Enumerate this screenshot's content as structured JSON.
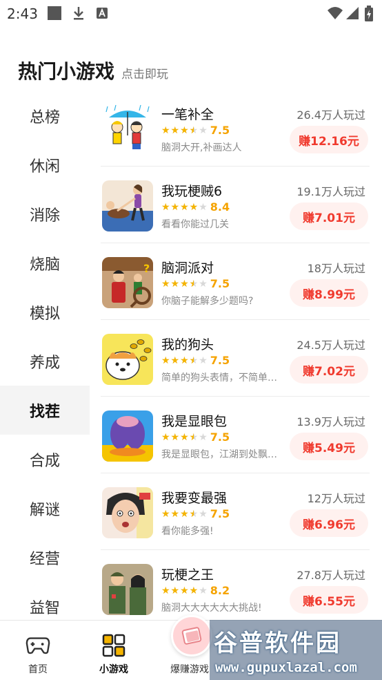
{
  "status_bar": {
    "time": "2:43"
  },
  "header": {
    "title": "热门小游戏",
    "subtitle": "点击即玩"
  },
  "categories": [
    {
      "label": "总榜",
      "active": false
    },
    {
      "label": "休闲",
      "active": false
    },
    {
      "label": "消除",
      "active": false
    },
    {
      "label": "烧脑",
      "active": false
    },
    {
      "label": "模拟",
      "active": false
    },
    {
      "label": "养成",
      "active": false
    },
    {
      "label": "找茬",
      "active": true
    },
    {
      "label": "合成",
      "active": false
    },
    {
      "label": "解谜",
      "active": false
    },
    {
      "label": "经营",
      "active": false
    },
    {
      "label": "益智",
      "active": false
    }
  ],
  "games": [
    {
      "name": "一笔补全",
      "rating": 7.5,
      "rating_label": "7.5",
      "stars": 3.5,
      "desc": "脑洞大开,补画达人",
      "plays": "26.4万人玩过",
      "earn": "赚12.16元"
    },
    {
      "name": "我玩梗贼6",
      "rating": 8.4,
      "rating_label": "8.4",
      "stars": 4,
      "desc": "看看你能过几关",
      "plays": "19.1万人玩过",
      "earn": "赚7.01元"
    },
    {
      "name": "脑洞派对",
      "rating": 7.5,
      "rating_label": "7.5",
      "stars": 3.5,
      "desc": "你脑子能解多少题吗?",
      "plays": "18万人玩过",
      "earn": "赚8.99元"
    },
    {
      "name": "我的狗头",
      "rating": 7.5,
      "rating_label": "7.5",
      "stars": 3.5,
      "desc": "简单的狗头表情，不简单…",
      "plays": "24.5万人玩过",
      "earn": "赚7.02元"
    },
    {
      "name": "我是显眼包",
      "rating": 7.5,
      "rating_label": "7.5",
      "stars": 3.5,
      "desc": "我是显眼包，江湖到处飘…",
      "plays": "13.9万人玩过",
      "earn": "赚5.49元"
    },
    {
      "name": "我要变最强",
      "rating": 7.5,
      "rating_label": "7.5",
      "stars": 3.5,
      "desc": "看你能多强!",
      "plays": "12万人玩过",
      "earn": "赚6.96元"
    },
    {
      "name": "玩梗之王",
      "rating": 8.2,
      "rating_label": "8.2",
      "stars": 4,
      "desc": "脑洞大大大大大大挑战!",
      "plays": "27.8万人玩过",
      "earn": "赚6.55元"
    }
  ],
  "tab_bar": {
    "tabs": [
      {
        "label": "首页",
        "icon": "gamepad-icon",
        "active": false
      },
      {
        "label": "小游戏",
        "icon": "grid-icon",
        "active": true
      },
      {
        "label": "爆赚游戏",
        "icon": "money-icon",
        "active": false
      }
    ]
  },
  "watermark": {
    "title": "谷普软件园",
    "url": "www.gupuxlazal.com"
  },
  "colors": {
    "accent_red": "#f03a2e",
    "star_yellow": "#f5b400",
    "active_bg": "#f4f4f4"
  }
}
